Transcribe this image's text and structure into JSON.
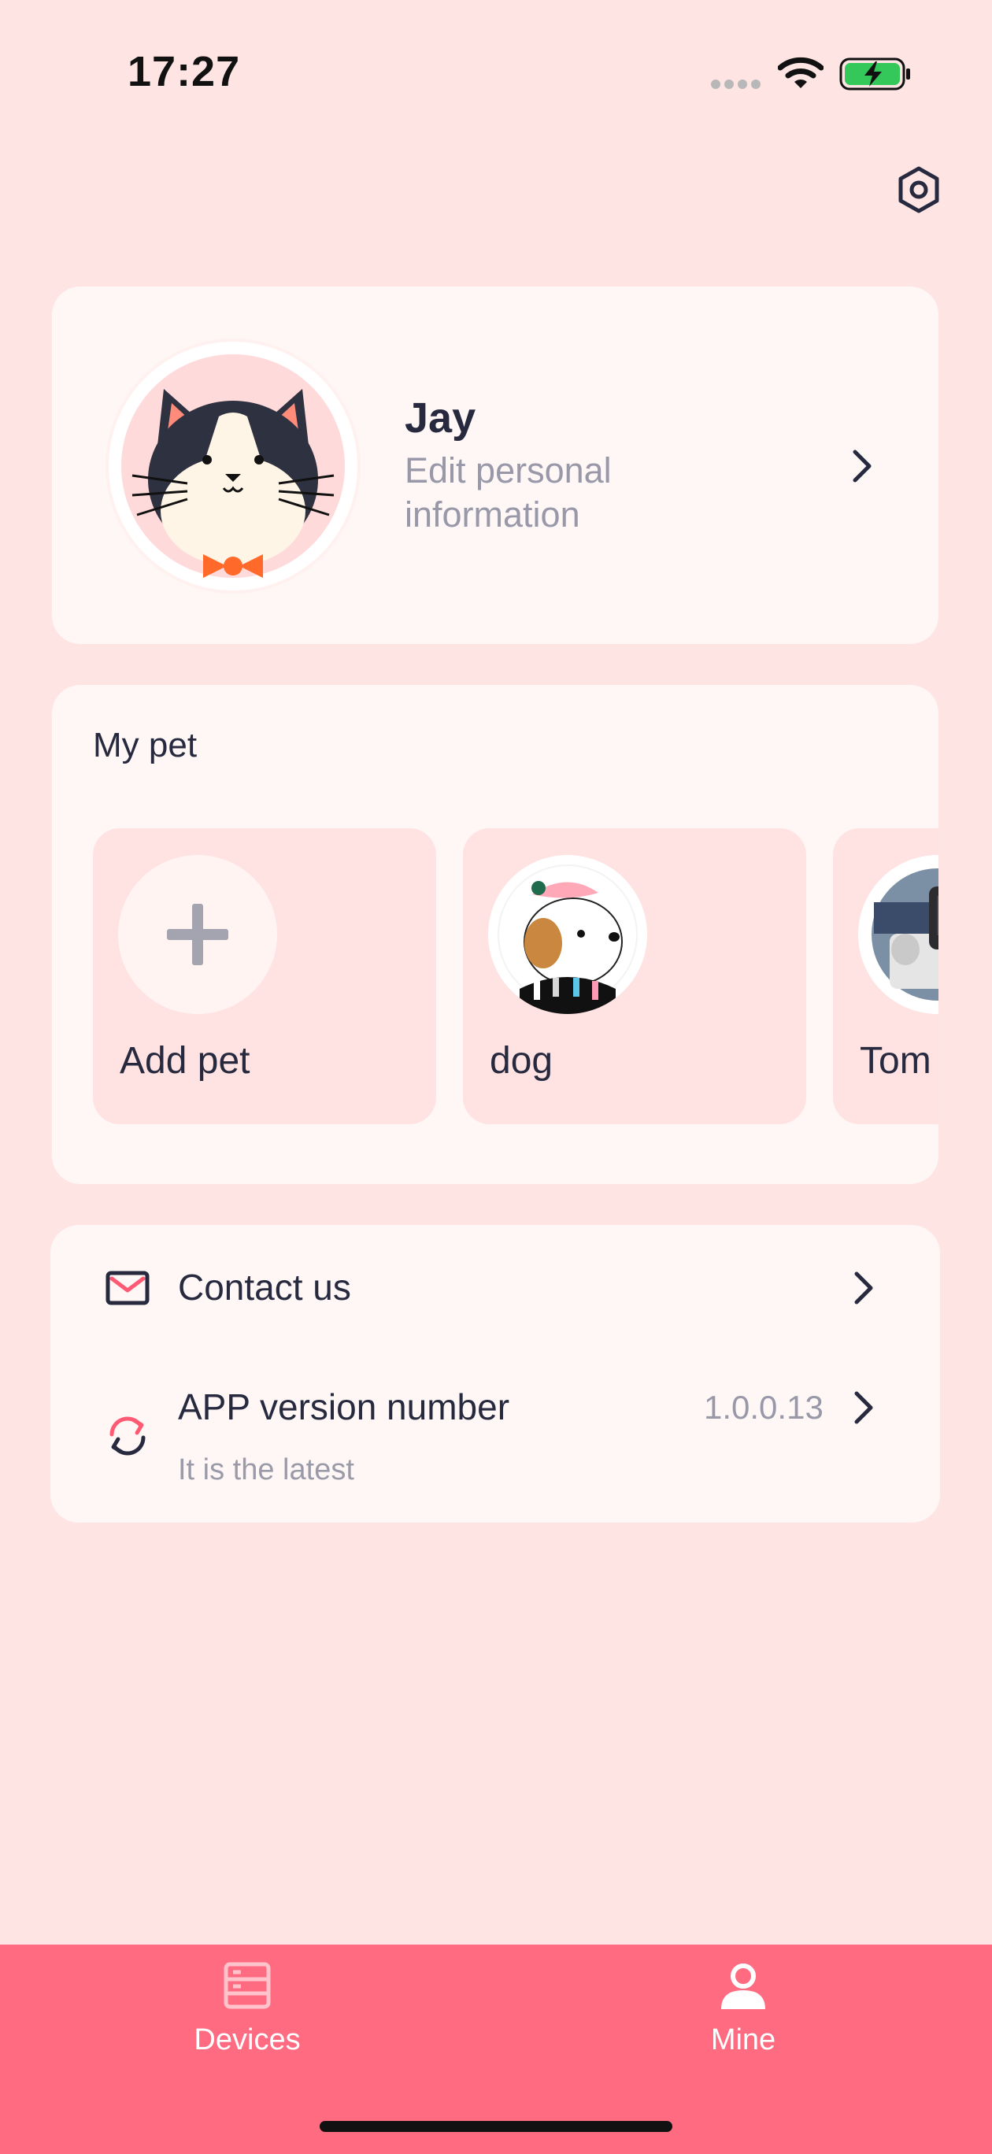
{
  "status_bar": {
    "time": "17:27",
    "icons": [
      "signal-dots-icon",
      "wifi-icon",
      "battery-charging-icon"
    ]
  },
  "header": {
    "settings_icon": "settings-hexagon-icon"
  },
  "profile": {
    "name": "Jay",
    "subtitle": "Edit personal information",
    "avatar_icon": "cat-avatar-icon"
  },
  "pets": {
    "title": "My pet",
    "items": [
      {
        "name": "Add pet",
        "icon": "plus-icon"
      },
      {
        "name": "dog",
        "icon": "dog-avatar-icon"
      },
      {
        "name": "Tom",
        "icon": "device-photo-icon"
      }
    ]
  },
  "settings_list": {
    "contact": {
      "label": "Contact us",
      "icon": "mail-icon"
    },
    "version": {
      "label": "APP version number",
      "value": "1.0.0.13",
      "status": "It is the latest",
      "icon": "refresh-icon"
    }
  },
  "tab_bar": {
    "tabs": [
      {
        "label": "Devices",
        "icon": "devices-icon"
      },
      {
        "label": "Mine",
        "icon": "person-icon"
      }
    ]
  },
  "colors": {
    "background": "#ffe4e4",
    "card": "#fff7f5",
    "accent": "#ff6b81",
    "text": "#272a3f",
    "muted": "#9898a8"
  }
}
